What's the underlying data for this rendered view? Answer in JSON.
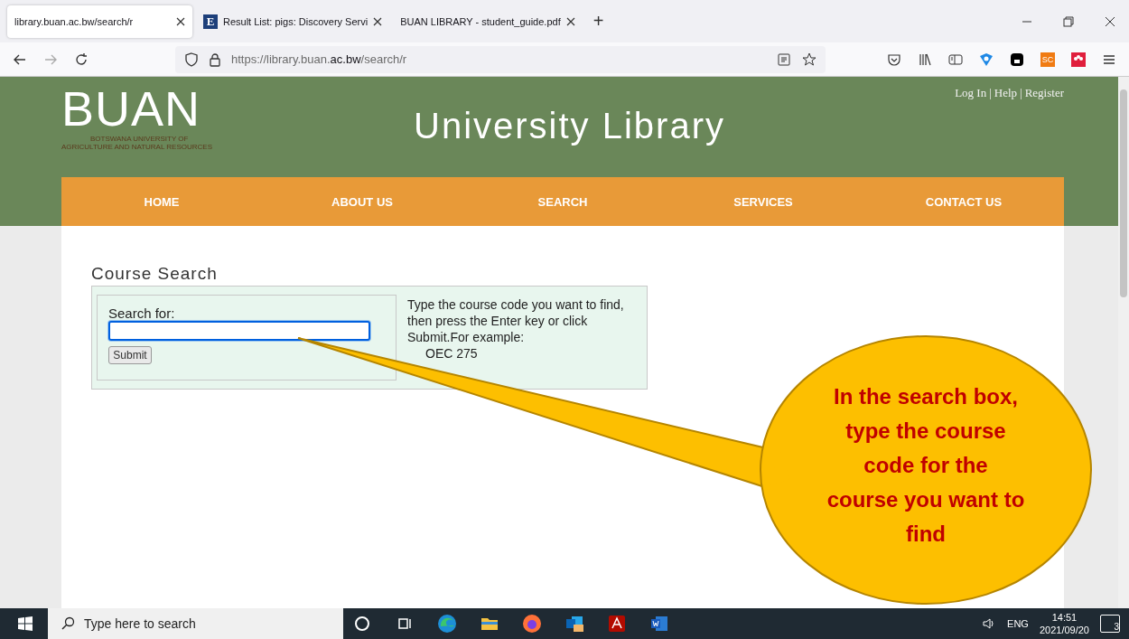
{
  "browser": {
    "tabs": [
      {
        "label": "library.buan.ac.bw/search/r",
        "selected": true
      },
      {
        "label": "Result List: pigs: Discovery Servi",
        "selected": false,
        "favicon": "E"
      },
      {
        "label": "BUAN LIBRARY - student_guide.pdf",
        "selected": false
      }
    ],
    "new_tab": "+",
    "address": {
      "prefix": "https://library.buan.",
      "domain": "ac.bw",
      "path": "/search/r"
    },
    "extension_badge": "SC"
  },
  "site": {
    "logo": {
      "name": "BUAN",
      "tagline_1": "BOTSWANA UNIVERSITY OF",
      "tagline_2": "AGRICULTURE AND NATURAL RESOURCES"
    },
    "title": "University Library",
    "account_links": [
      "Log In",
      "Help",
      "Register"
    ],
    "separator": "|",
    "nav": [
      "HOME",
      "ABOUT US",
      "SEARCH",
      "SERVICES",
      "CONTACT US"
    ]
  },
  "course_search": {
    "heading": "Course Search",
    "label": "Search for:",
    "submit": "Submit",
    "help": "Type the course code you want to find, then press the Enter key or click Submit.For example:",
    "example": "OEC 275"
  },
  "callout": {
    "text": "In the search box, type the course code for the course you want to find"
  },
  "taskbar": {
    "search_placeholder": "Type here to search",
    "language": "ENG",
    "time": "14:51",
    "date": "2021/09/20",
    "notifications": "3"
  }
}
